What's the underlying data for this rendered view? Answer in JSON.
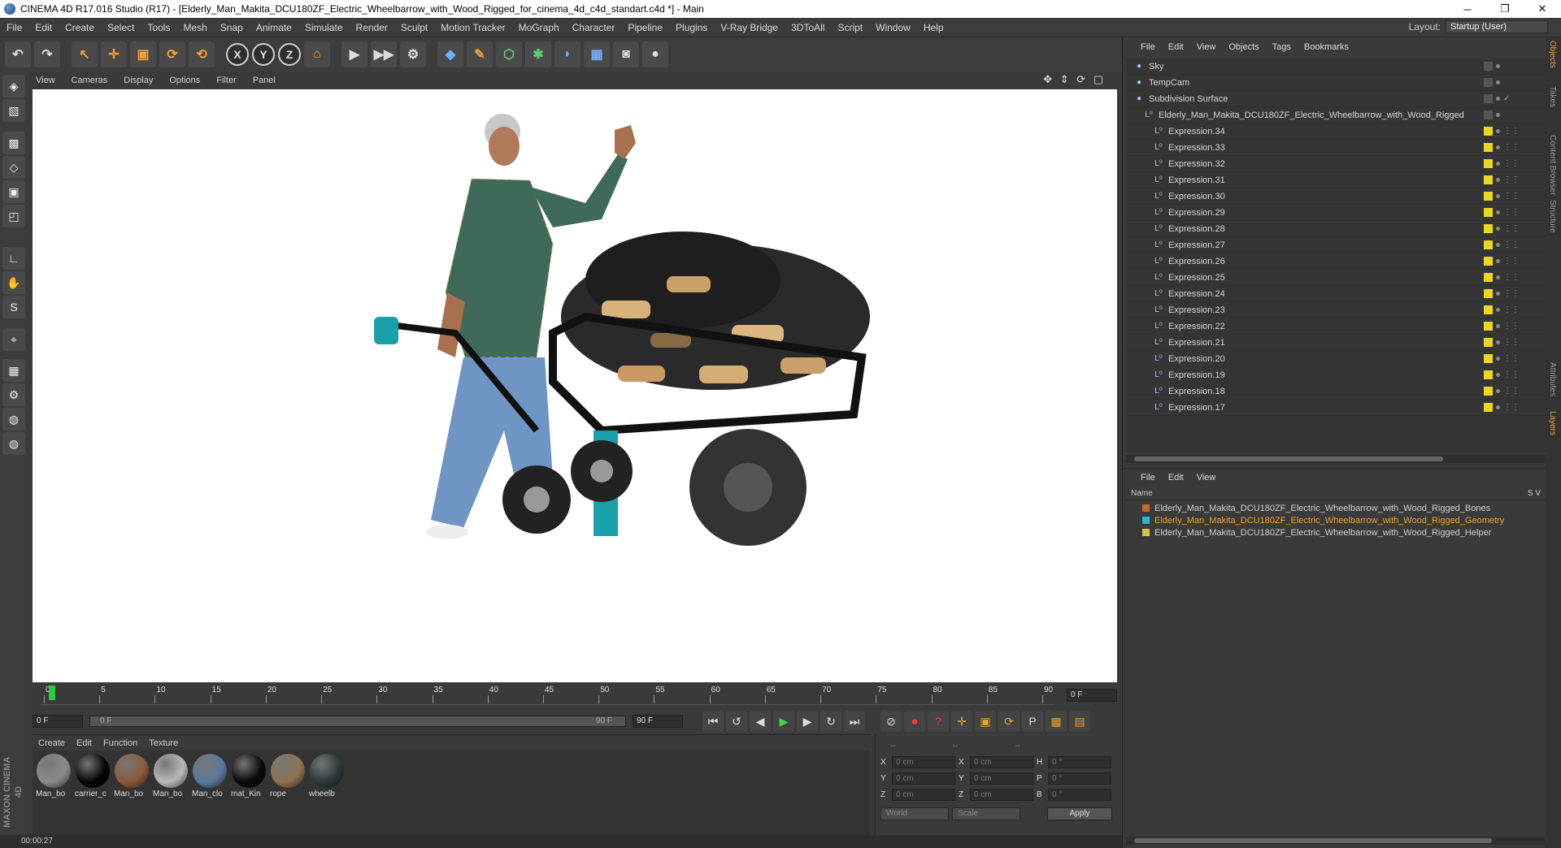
{
  "window": {
    "title": "CINEMA 4D R17.016 Studio (R17) - [Elderly_Man_Makita_DCU180ZF_Electric_Wheelbarrow_with_Wood_Rigged_for_cinema_4d_c4d_standart.c4d *] - Main",
    "minimize": "─",
    "restore": "❐",
    "close": "✕"
  },
  "menu": [
    "File",
    "Edit",
    "Create",
    "Select",
    "Tools",
    "Mesh",
    "Snap",
    "Animate",
    "Simulate",
    "Render",
    "Sculpt",
    "Motion Tracker",
    "MoGraph",
    "Character",
    "Pipeline",
    "Plugins",
    "V-Ray Bridge",
    "3DToAll",
    "Script",
    "Window",
    "Help"
  ],
  "layout": {
    "label": "Layout:",
    "value": "Startup (User)"
  },
  "toolbar": {
    "undo": "↶",
    "redo": "↷",
    "select": "↖",
    "move": "✛",
    "scale": "▣",
    "rotate": "⟳",
    "recent": "⟲",
    "x": "X",
    "y": "Y",
    "z": "Z",
    "world": "⌂",
    "render_view": "▶",
    "render_pic": "▶▶",
    "render_settings": "⚙",
    "cube": "◆",
    "spline": "✎",
    "nurbs": "⬡",
    "array": "✱",
    "deform": "◗",
    "floor": "▦",
    "camera": "◙",
    "light": "●"
  },
  "left_palette": [
    "◈",
    "▧",
    "▩",
    "◇",
    "▣",
    "◰",
    "∟",
    "✋",
    "S",
    "⌖",
    "▦",
    "⚙",
    "◍",
    "◍"
  ],
  "viewport": {
    "menu": [
      "View",
      "Cameras",
      "Display",
      "Options",
      "Filter",
      "Panel"
    ],
    "nav": "✥ ⇕ ⟳ ▢"
  },
  "timeline": {
    "ticks": [
      "0",
      "5",
      "10",
      "15",
      "20",
      "25",
      "30",
      "35",
      "40",
      "45",
      "50",
      "55",
      "60",
      "65",
      "70",
      "75",
      "80",
      "85",
      "90"
    ],
    "current": "0 F",
    "start": "0 F",
    "range_start": "0 F",
    "range_end": "90 F",
    "end": "90 F"
  },
  "transport": [
    "⏮",
    "↺",
    "◀",
    "▶",
    "▶",
    "↻",
    "⏭"
  ],
  "transport_right": [
    "⊘",
    "⏺",
    "?",
    "✛",
    "▣",
    "⟳",
    "P",
    "▦",
    "▤"
  ],
  "materials_menu": [
    "Create",
    "Edit",
    "Function",
    "Texture"
  ],
  "materials": [
    {
      "label": "Man_bo",
      "color": "#8a8a8a"
    },
    {
      "label": "carrier_c",
      "color": "#050505"
    },
    {
      "label": "Man_bo",
      "color": "#8b5a3c"
    },
    {
      "label": "Man_bo",
      "color": "#b8b8b8"
    },
    {
      "label": "Man_clo",
      "color": "#5a7a9a"
    },
    {
      "label": "mat_Kin",
      "color": "#0a0a0a"
    },
    {
      "label": "rope",
      "color": "#8c7350"
    },
    {
      "label": "wheelb",
      "color": "#2a3a3a"
    }
  ],
  "maxon": "MAXON CINEMA 4D",
  "coords": {
    "header": [
      "--",
      "--",
      "--"
    ],
    "rows": [
      {
        "a": "X",
        "av": "0 cm",
        "b": "X",
        "bv": "0 cm",
        "c": "H",
        "cv": "0 °"
      },
      {
        "a": "Y",
        "av": "0 cm",
        "b": "Y",
        "bv": "0 cm",
        "c": "P",
        "cv": "0 °"
      },
      {
        "a": "Z",
        "av": "0 cm",
        "b": "Z",
        "bv": "0 cm",
        "c": "B",
        "cv": "0 °"
      }
    ],
    "world": "World",
    "scale": "Scale",
    "apply": "Apply"
  },
  "status": "00:00:27",
  "object_manager": {
    "menu": [
      "File",
      "Edit",
      "View",
      "Objects",
      "Tags",
      "Bookmarks"
    ],
    "objects": [
      {
        "name": "Sky",
        "indent": 0,
        "tag": "none"
      },
      {
        "name": "TempCam",
        "indent": 0,
        "tag": "none"
      },
      {
        "name": "Subdivision Surface",
        "indent": 0,
        "tag": "check"
      },
      {
        "name": "Elderly_Man_Makita_DCU180ZF_Electric_Wheelbarrow_with_Wood_Rigged",
        "indent": 1,
        "tag": "none"
      },
      {
        "name": "Expression.34",
        "indent": 2,
        "tag": "yellow"
      },
      {
        "name": "Expression.33",
        "indent": 2,
        "tag": "yellow"
      },
      {
        "name": "Expression.32",
        "indent": 2,
        "tag": "yellow"
      },
      {
        "name": "Expression.31",
        "indent": 2,
        "tag": "yellow"
      },
      {
        "name": "Expression.30",
        "indent": 2,
        "tag": "yellow"
      },
      {
        "name": "Expression.29",
        "indent": 2,
        "tag": "yellow"
      },
      {
        "name": "Expression.28",
        "indent": 2,
        "tag": "yellow"
      },
      {
        "name": "Expression.27",
        "indent": 2,
        "tag": "yellow"
      },
      {
        "name": "Expression.26",
        "indent": 2,
        "tag": "yellow"
      },
      {
        "name": "Expression.25",
        "indent": 2,
        "tag": "yellow"
      },
      {
        "name": "Expression.24",
        "indent": 2,
        "tag": "yellow"
      },
      {
        "name": "Expression.23",
        "indent": 2,
        "tag": "yellow"
      },
      {
        "name": "Expression.22",
        "indent": 2,
        "tag": "yellow"
      },
      {
        "name": "Expression.21",
        "indent": 2,
        "tag": "yellow"
      },
      {
        "name": "Expression.20",
        "indent": 2,
        "tag": "yellow"
      },
      {
        "name": "Expression.19",
        "indent": 2,
        "tag": "yellow"
      },
      {
        "name": "Expression.18",
        "indent": 2,
        "tag": "yellow"
      },
      {
        "name": "Expression.17",
        "indent": 2,
        "tag": "yellow"
      }
    ]
  },
  "layer_manager": {
    "menu": [
      "File",
      "Edit",
      "View"
    ],
    "header_name": "Name",
    "header_sv": "S   V",
    "layers": [
      {
        "name": "Elderly_Man_Makita_DCU180ZF_Electric_Wheelbarrow_with_Wood_Rigged_Bones",
        "color": "#c86a2a",
        "text_color": "#d0d0d0"
      },
      {
        "name": "Elderly_Man_Makita_DCU180ZF_Electric_Wheelbarrow_with_Wood_Rigged_Geometry",
        "color": "#2ab6c8",
        "text_color": "#f0a030"
      },
      {
        "name": "Elderly_Man_Makita_DCU180ZF_Electric_Wheelbarrow_with_Wood_Rigged_Helper",
        "color": "#d8c830",
        "text_color": "#d0d0d0"
      }
    ]
  },
  "vertical_tabs": [
    "Objects",
    "Takes",
    "Content Browser",
    "Structure",
    "Attributes",
    "Layers"
  ]
}
